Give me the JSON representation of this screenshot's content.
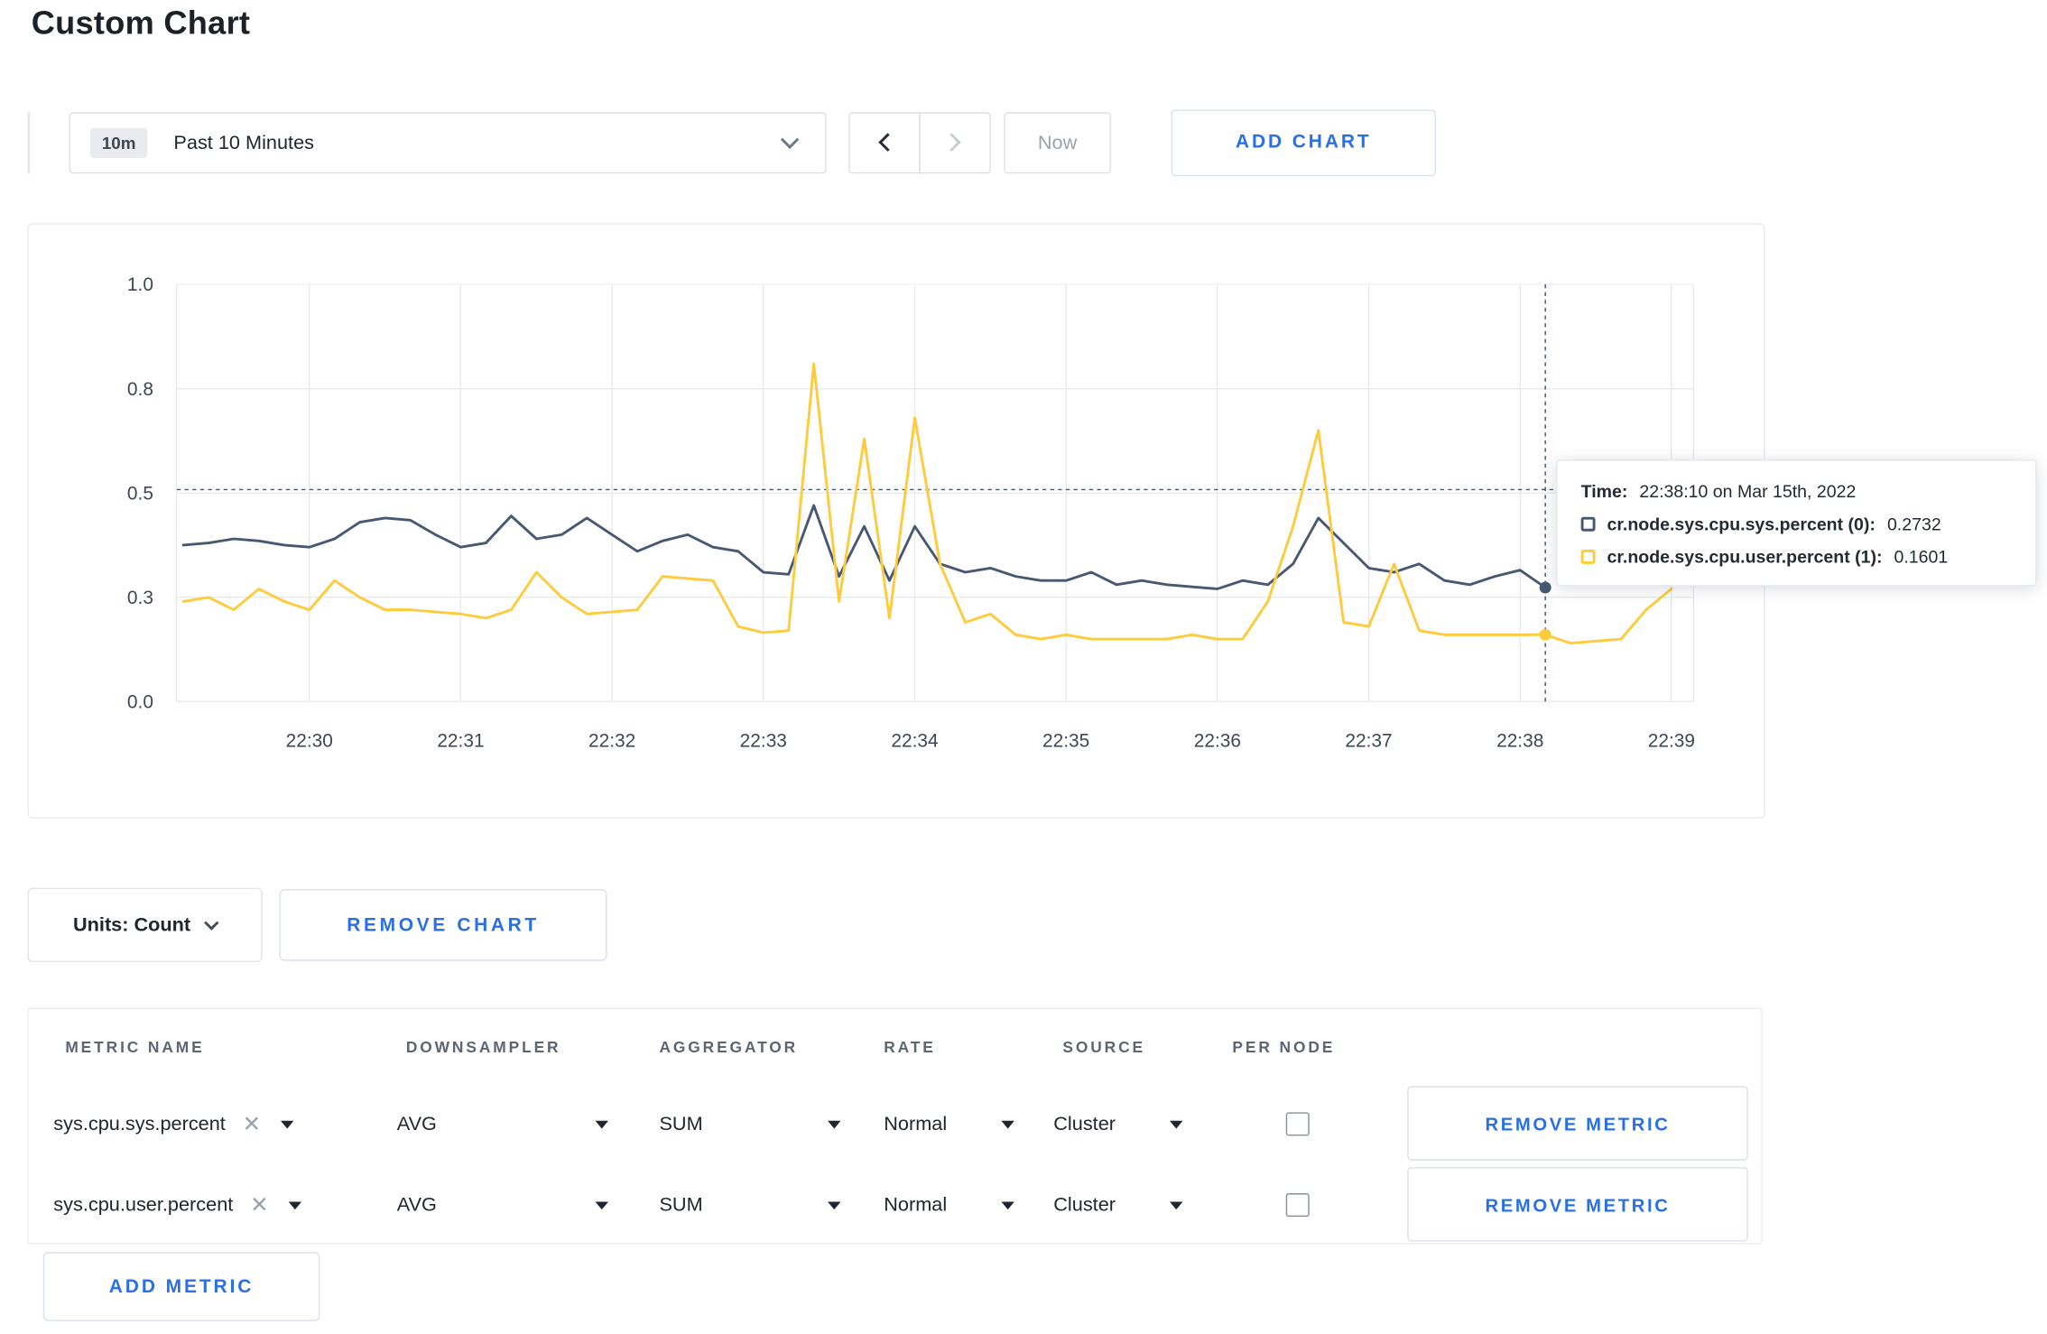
{
  "page": {
    "title": "Custom Chart"
  },
  "colors": {
    "accent_blue": "#2a6fe4",
    "series_sys": "#475872",
    "series_user": "#ffcb3d"
  },
  "toolbar": {
    "time_range_badge": "10m",
    "time_range_label": "Past 10 Minutes",
    "now_label": "Now",
    "add_chart_label": "ADD CHART"
  },
  "chart": {
    "tooltip": {
      "time_label": "Time:",
      "time_value": "22:38:10 on Mar 15th, 2022",
      "series": [
        {
          "name": "cr.node.sys.cpu.sys.percent (0):",
          "value": "0.2732",
          "color": "#475872"
        },
        {
          "name": "cr.node.sys.cpu.user.percent (1):",
          "value": "0.1601",
          "color": "#ffcb3d"
        }
      ]
    }
  },
  "chart_controls": {
    "units_label": "Units: Count",
    "remove_chart_label": "REMOVE CHART"
  },
  "metrics_table": {
    "headers": [
      "METRIC NAME",
      "DOWNSAMPLER",
      "AGGREGATOR",
      "RATE",
      "SOURCE",
      "PER NODE"
    ],
    "rows": [
      {
        "metric": "sys.cpu.sys.percent",
        "downsampler": "AVG",
        "aggregator": "SUM",
        "rate": "Normal",
        "source": "Cluster",
        "per_node_checked": false,
        "remove_label": "REMOVE METRIC"
      },
      {
        "metric": "sys.cpu.user.percent",
        "downsampler": "AVG",
        "aggregator": "SUM",
        "rate": "Normal",
        "source": "Cluster",
        "per_node_checked": false,
        "remove_label": "REMOVE METRIC"
      }
    ],
    "add_metric_label": "ADD METRIC"
  },
  "chart_data": {
    "type": "line",
    "title": "",
    "x_unit": "seconds since 22:29:00, Mar 15th 2022",
    "ylim": [
      0,
      1
    ],
    "grid": true,
    "legend_position": "tooltip",
    "y_ticks": [
      {
        "v": 0,
        "label": "0.0"
      },
      {
        "v": 0.25,
        "label": "0.3"
      },
      {
        "v": 0.5,
        "label": "0.5"
      },
      {
        "v": 0.75,
        "label": "0.8"
      },
      {
        "v": 1,
        "label": "1.0"
      }
    ],
    "x_ticks": [
      {
        "t": 60,
        "label": "22:30"
      },
      {
        "t": 120,
        "label": "22:31"
      },
      {
        "t": 180,
        "label": "22:32"
      },
      {
        "t": 240,
        "label": "22:33"
      },
      {
        "t": 300,
        "label": "22:34"
      },
      {
        "t": 360,
        "label": "22:35"
      },
      {
        "t": 420,
        "label": "22:36"
      },
      {
        "t": 480,
        "label": "22:37"
      },
      {
        "t": 540,
        "label": "22:38"
      },
      {
        "t": 600,
        "label": "22:39"
      }
    ],
    "crosshair": {
      "t": 550,
      "v": 0.508,
      "dots": [
        {
          "t": 550,
          "v": 0.2732,
          "color": "#475872"
        },
        {
          "t": 550,
          "v": 0.1601,
          "color": "#ffcb3d"
        }
      ]
    },
    "series": [
      {
        "name": "cr.node.sys.cpu.sys.percent",
        "color": "#475872",
        "points": [
          [
            10,
            0.375
          ],
          [
            20,
            0.38
          ],
          [
            30,
            0.39
          ],
          [
            40,
            0.385
          ],
          [
            50,
            0.375
          ],
          [
            60,
            0.37
          ],
          [
            70,
            0.39
          ],
          [
            80,
            0.43
          ],
          [
            90,
            0.44
          ],
          [
            100,
            0.435
          ],
          [
            110,
            0.4
          ],
          [
            120,
            0.37
          ],
          [
            130,
            0.38
          ],
          [
            140,
            0.445
          ],
          [
            150,
            0.39
          ],
          [
            160,
            0.4
          ],
          [
            170,
            0.44
          ],
          [
            180,
            0.4
          ],
          [
            190,
            0.36
          ],
          [
            200,
            0.385
          ],
          [
            210,
            0.4
          ],
          [
            220,
            0.37
          ],
          [
            230,
            0.36
          ],
          [
            240,
            0.31
          ],
          [
            250,
            0.305
          ],
          [
            260,
            0.47
          ],
          [
            270,
            0.3
          ],
          [
            280,
            0.42
          ],
          [
            290,
            0.29
          ],
          [
            300,
            0.42
          ],
          [
            310,
            0.33
          ],
          [
            320,
            0.31
          ],
          [
            330,
            0.32
          ],
          [
            340,
            0.3
          ],
          [
            350,
            0.29
          ],
          [
            360,
            0.29
          ],
          [
            370,
            0.31
          ],
          [
            380,
            0.28
          ],
          [
            390,
            0.29
          ],
          [
            400,
            0.28
          ],
          [
            410,
            0.275
          ],
          [
            420,
            0.27
          ],
          [
            430,
            0.29
          ],
          [
            440,
            0.28
          ],
          [
            450,
            0.33
          ],
          [
            460,
            0.44
          ],
          [
            470,
            0.38
          ],
          [
            480,
            0.32
          ],
          [
            490,
            0.31
          ],
          [
            500,
            0.33
          ],
          [
            510,
            0.29
          ],
          [
            520,
            0.28
          ],
          [
            530,
            0.3
          ],
          [
            540,
            0.315
          ],
          [
            550,
            0.2732
          ]
        ]
      },
      {
        "name": "cr.node.sys.cpu.user.percent",
        "color": "#ffcb3d",
        "points": [
          [
            10,
            0.24
          ],
          [
            20,
            0.25
          ],
          [
            30,
            0.22
          ],
          [
            40,
            0.27
          ],
          [
            50,
            0.24
          ],
          [
            60,
            0.22
          ],
          [
            70,
            0.29
          ],
          [
            80,
            0.25
          ],
          [
            90,
            0.22
          ],
          [
            100,
            0.22
          ],
          [
            110,
            0.215
          ],
          [
            120,
            0.21
          ],
          [
            130,
            0.2
          ],
          [
            140,
            0.22
          ],
          [
            150,
            0.31
          ],
          [
            160,
            0.25
          ],
          [
            170,
            0.21
          ],
          [
            180,
            0.215
          ],
          [
            190,
            0.22
          ],
          [
            200,
            0.3
          ],
          [
            210,
            0.295
          ],
          [
            220,
            0.29
          ],
          [
            230,
            0.18
          ],
          [
            240,
            0.165
          ],
          [
            250,
            0.17
          ],
          [
            260,
            0.81
          ],
          [
            270,
            0.24
          ],
          [
            280,
            0.63
          ],
          [
            290,
            0.2
          ],
          [
            300,
            0.68
          ],
          [
            310,
            0.33
          ],
          [
            320,
            0.19
          ],
          [
            330,
            0.21
          ],
          [
            340,
            0.16
          ],
          [
            350,
            0.15
          ],
          [
            360,
            0.16
          ],
          [
            370,
            0.15
          ],
          [
            380,
            0.15
          ],
          [
            390,
            0.15
          ],
          [
            400,
            0.15
          ],
          [
            410,
            0.16
          ],
          [
            420,
            0.15
          ],
          [
            430,
            0.15
          ],
          [
            440,
            0.24
          ],
          [
            450,
            0.42
          ],
          [
            460,
            0.65
          ],
          [
            470,
            0.19
          ],
          [
            480,
            0.18
          ],
          [
            490,
            0.33
          ],
          [
            500,
            0.17
          ],
          [
            510,
            0.16
          ],
          [
            520,
            0.16
          ],
          [
            530,
            0.16
          ],
          [
            540,
            0.16
          ],
          [
            550,
            0.1601
          ],
          [
            560,
            0.14
          ],
          [
            570,
            0.145
          ],
          [
            580,
            0.15
          ],
          [
            590,
            0.22
          ],
          [
            600,
            0.27
          ]
        ]
      }
    ]
  }
}
